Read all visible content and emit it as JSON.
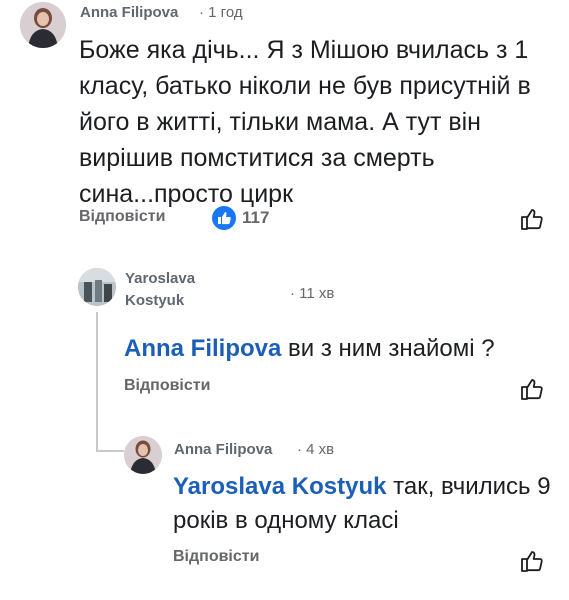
{
  "comment1": {
    "author": "Anna Filipova",
    "time": "· 1 год",
    "text": "Боже яка дічь... Я з Мішою вчилась з 1 класу, батько ніколи не був присутній в його в житті, тільки мама. А тут він вирішив помститися за смерть сина...просто цирк",
    "reply_label": "Відповісти",
    "reaction_count": "117"
  },
  "comment2": {
    "author_line1": "Yaroslava",
    "author_line2": "Kostyuk",
    "time": "· 11 хв",
    "mention": "Anna Filipova",
    "text": "ви з ним знайомі ?",
    "reply_label": "Відповісти"
  },
  "comment3": {
    "author": "Anna Filipova",
    "time": "· 4 хв",
    "mention": "Yaroslava Kostyuk",
    "text": "так, вчились 9 років в одному класі",
    "reply_label": "Відповісти"
  },
  "colors": {
    "mention": "#1b5fb8",
    "like_blue": "#1877f2",
    "thread_line": "#c7c9cc"
  }
}
